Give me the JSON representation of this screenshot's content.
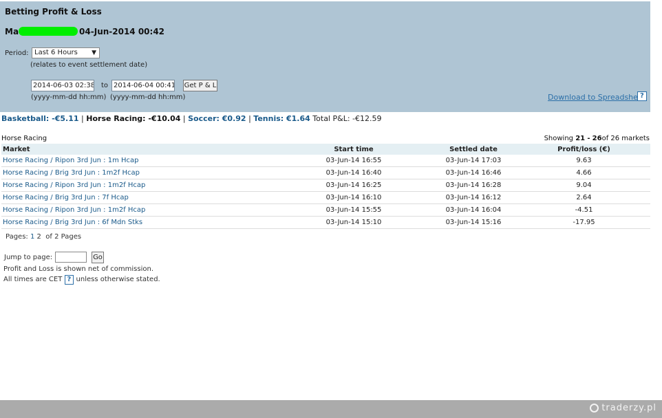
{
  "header": {
    "title": "Betting Profit & Loss",
    "account_prefix": "Ma",
    "account_time": "04-Jun-2014 00:42",
    "period_label": "Period:",
    "period_value": "Last 6 Hours",
    "period_hint": "(relates to event settlement date)",
    "from_date": "2014-06-03 02:38",
    "to_label": "to",
    "to_date": "2014-06-04 00:41",
    "date_format": "(yyyy-mm-dd hh:mm)",
    "get_button": "Get P & L",
    "download_link": "Download to Spreadsheet",
    "help_glyph": "?"
  },
  "sports": {
    "basketball": "Basketball: -€5.11",
    "horse_racing": "Horse Racing: -€10.04",
    "soccer": "Soccer: €0.92",
    "tennis": "Tennis: €1.64",
    "total_label": "Total P&L:",
    "total_value": "-€12.59",
    "separator": "|"
  },
  "section": {
    "title": "Horse Racing",
    "showing_prefix": "Showing",
    "range_start": "21",
    "range_dash": "-",
    "range_end": "26",
    "showing_suffix": "of 26 markets"
  },
  "table": {
    "headers": {
      "market": "Market",
      "start": "Start time",
      "settled": "Settled date",
      "pl": "Profit/loss (€)"
    },
    "rows": [
      {
        "market": "Horse Racing / Ripon 3rd Jun : 1m Hcap",
        "start": "03-Jun-14 16:55",
        "settled": "03-Jun-14 17:03",
        "pl": "9.63"
      },
      {
        "market": "Horse Racing / Brig 3rd Jun : 1m2f Hcap",
        "start": "03-Jun-14 16:40",
        "settled": "03-Jun-14 16:46",
        "pl": "4.66"
      },
      {
        "market": "Horse Racing / Ripon 3rd Jun : 1m2f Hcap",
        "start": "03-Jun-14 16:25",
        "settled": "03-Jun-14 16:28",
        "pl": "9.04"
      },
      {
        "market": "Horse Racing / Brig 3rd Jun : 7f Hcap",
        "start": "03-Jun-14 16:10",
        "settled": "03-Jun-14 16:12",
        "pl": "2.64"
      },
      {
        "market": "Horse Racing / Ripon 3rd Jun : 1m2f Hcap",
        "start": "03-Jun-14 15:55",
        "settled": "03-Jun-14 16:04",
        "pl": "-4.51"
      },
      {
        "market": "Horse Racing / Brig 3rd Jun : 6f Mdn Stks",
        "start": "03-Jun-14 15:10",
        "settled": "03-Jun-14 15:16",
        "pl": "-17.95"
      }
    ]
  },
  "pagination": {
    "label": "Pages:",
    "page1": "1",
    "page2": "2",
    "of_text": "of 2 Pages",
    "jump_label": "Jump to page:",
    "go_button": "Go"
  },
  "notes": {
    "commission": "Profit and Loss is shown net of commission.",
    "times_prefix": "All times are CET",
    "times_suffix": "unless otherwise stated."
  },
  "footer": {
    "logo_text": "traderzy.pl"
  },
  "colors": {
    "header_bg": "#afc5d4",
    "table_header_bg": "#e4eff3",
    "link": "#1a5a8a",
    "footer_bg": "#ababab",
    "redaction": "#00ee00"
  }
}
